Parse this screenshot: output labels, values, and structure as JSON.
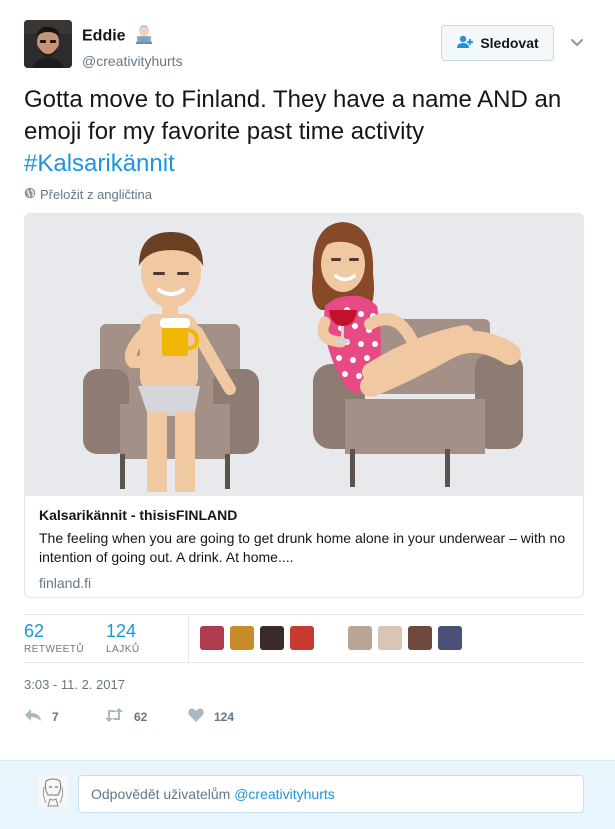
{
  "author": {
    "display_name": "Eddie",
    "handle": "@creativityhurts",
    "name_emoji": "man-technologist-emoji"
  },
  "follow_button": {
    "label": "Sledovat",
    "icon": "add-user-icon"
  },
  "menu": {
    "icon": "chevron-down-icon"
  },
  "tweet": {
    "text": "Gotta move to Finland.  They have a name AND an emoji for my favorite past time activity",
    "hashtag": "#Kalsarikännit"
  },
  "translate": {
    "label": "Přeložit z angličtina",
    "icon": "globe-icon"
  },
  "card": {
    "title": "Kalsarikännit - thisisFINLAND",
    "description": "The feeling when you are going to get drunk home alone in your underwear – with no intention of going out. A drink. At home....",
    "domain": "finland.fi",
    "image": "illustration-man-with-beer-and-woman-with-wine-on-armchairs"
  },
  "stats": {
    "retweets": {
      "count": "62",
      "label": "RETWEETŮ"
    },
    "likes": {
      "count": "124",
      "label": "LAJKŮ"
    },
    "liker_faces": [
      "#b03a4e",
      "#c98a2a",
      "#3a2a28",
      "#c73b2f",
      "#b9a595",
      "#d9c4b6",
      "#6f4a3c",
      "#4a5078"
    ]
  },
  "timestamp": "3:03 - 11. 2. 2017",
  "actions": {
    "reply": {
      "count": "7",
      "icon": "reply-icon"
    },
    "retweet": {
      "count": "62",
      "icon": "retweet-icon"
    },
    "like": {
      "count": "124",
      "icon": "heart-icon"
    }
  },
  "reply": {
    "placeholder_prefix": "Odpovědět uživatelům ",
    "placeholder_mention": "@creativityhurts"
  },
  "colors": {
    "link_blue": "#1b95e0",
    "secondary_text": "#657786",
    "border": "#e1e8ed",
    "reply_bg": "#e8f5fd"
  }
}
